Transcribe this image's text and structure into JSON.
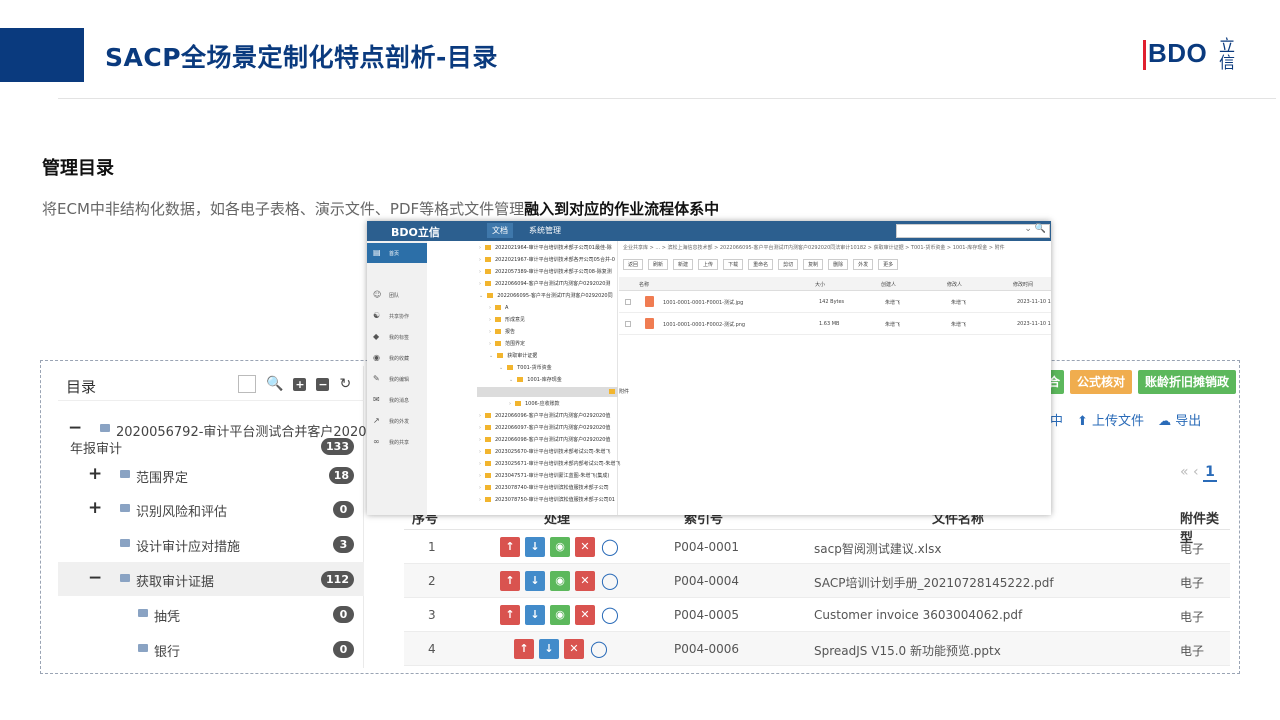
{
  "header": {
    "title": "SACP全场景定制化特点剖析-目录",
    "logo_text": "BDO",
    "logo_sub": "立信"
  },
  "section": {
    "title": "管理目录",
    "desc_plain": "将ECM中非结构化数据，如各电子表格、演示文件、PDF等格式文件管理",
    "desc_bold": "融入到对应的作业流程体系中"
  },
  "tree": {
    "title": "目录",
    "nodes": [
      {
        "label": "2020056792-审计平台测试合并客户2020",
        "label2": "年报审计",
        "badge": "133",
        "exp": "−"
      },
      {
        "label": "范围界定",
        "badge": "18",
        "exp": "+"
      },
      {
        "label": "识别风险和评估",
        "badge": "0",
        "exp": "+"
      },
      {
        "label": "设计审计应对措施",
        "badge": "3",
        "exp": ""
      },
      {
        "label": "获取审计证据",
        "badge": "112",
        "exp": "−"
      },
      {
        "label": "抽凭",
        "badge": "0",
        "exp": ""
      },
      {
        "label": "银行",
        "badge": "0",
        "exp": ""
      }
    ]
  },
  "right": {
    "btn_partial": "合",
    "btn_formula": "公式核对",
    "btn_depr": "账龄折旧摊销政",
    "action_partial": "中",
    "action_upload": "上传文件",
    "action_export": "导出",
    "pager_prev": "«  ‹",
    "pager_current": "1"
  },
  "table": {
    "headers": {
      "seq": "序号",
      "ops": "处理",
      "index": "索引号",
      "filename": "文件名称",
      "type": "附件类型"
    },
    "rows": [
      {
        "seq": "1",
        "index": "P004-0001",
        "filename": "sacp智阅测试建议.xlsx",
        "type": "电子"
      },
      {
        "seq": "2",
        "index": "P004-0004",
        "filename": "SACP培训计划手册_20210728145222.pdf",
        "type": "电子"
      },
      {
        "seq": "3",
        "index": "P004-0005",
        "filename": "Customer invoice 3603004062.pdf",
        "type": "电子"
      },
      {
        "seq": "4",
        "index": "P004-0006",
        "filename": "SpreadJS V15.0 新功能预览.pptx",
        "type": "电子"
      }
    ]
  },
  "popup": {
    "logo": "BDO立信",
    "tab_docs": "文档",
    "tab_sys": "系统管理",
    "side": [
      "首页",
      "团队",
      "共享协作",
      "我的标签",
      "我的收藏",
      "我的编辑",
      "我的消息",
      "我的外发",
      "我的共享"
    ],
    "tree": [
      "2022021964-审计平台培训技术部子公司01最佳-除",
      "2022021967-审计平台培训技术部各开公司05合并-0",
      "2022057389-审计平台培训技术部子公司08-除复测",
      "2022066094-客户平台测试IT内测客户0292020测",
      "2022066095-客户平台测试IT内测客户0292020同",
      "A",
      "形成意见",
      "报告",
      "范围界定",
      "获取审计证据",
      "T001-货币资金",
      "1001-库存现金",
      "附件",
      "1006-应收账款",
      "2022066096-客户平台测试IT内测客户0292020值",
      "2022066097-客户平台测试IT内测客户0292020值",
      "2022066098-客户平台测试IT内测客户0292020值",
      "2023025670-审计平台培训技术部考试公司-朱增飞",
      "2023025671-审计平台培训技术部内部考试公司-朱增飞",
      "2023047571-审计平台培训蒙江蓝图-朱增飞(集成)",
      "2023078740-审计平台培训滨松值服技术部子公司",
      "2023078750-审计平台培训滨松值服技术部子公司01"
    ],
    "breadcrumb": "企业共享库 > ... > 滨松上海信息技术部 > 2022066095-客户平台测试IT内测客户0292020同法审计10182 > 获取审计证据 > T001-货币资金 > 1001-库存现金 > 附件",
    "tools": [
      "返回",
      "刷新",
      "新建",
      "上传",
      "下载",
      "重命名",
      "剪切",
      "复制",
      "删除",
      "外发",
      "更多"
    ],
    "cols": {
      "name": "名称",
      "size": "大小",
      "creator": "创建人",
      "modifier": "修改人",
      "mtime": "修改时间"
    },
    "files": [
      {
        "name": "1001-0001-0001-F0001-测试.jpg",
        "size": "142 Bytes",
        "creator": "朱增飞",
        "modifier": "朱增飞",
        "mtime": "2023-11-10 1"
      },
      {
        "name": "1001-0001-0001-F0002-测试.png",
        "size": "1.63 MB",
        "creator": "朱增飞",
        "modifier": "朱增飞",
        "mtime": "2023-11-10 1"
      }
    ]
  },
  "colors": {
    "brand": "#0a3a7e",
    "accent_red": "#e0202f",
    "orange": "#f0ad4e",
    "green": "#5cb85c",
    "blue": "#428bca"
  }
}
